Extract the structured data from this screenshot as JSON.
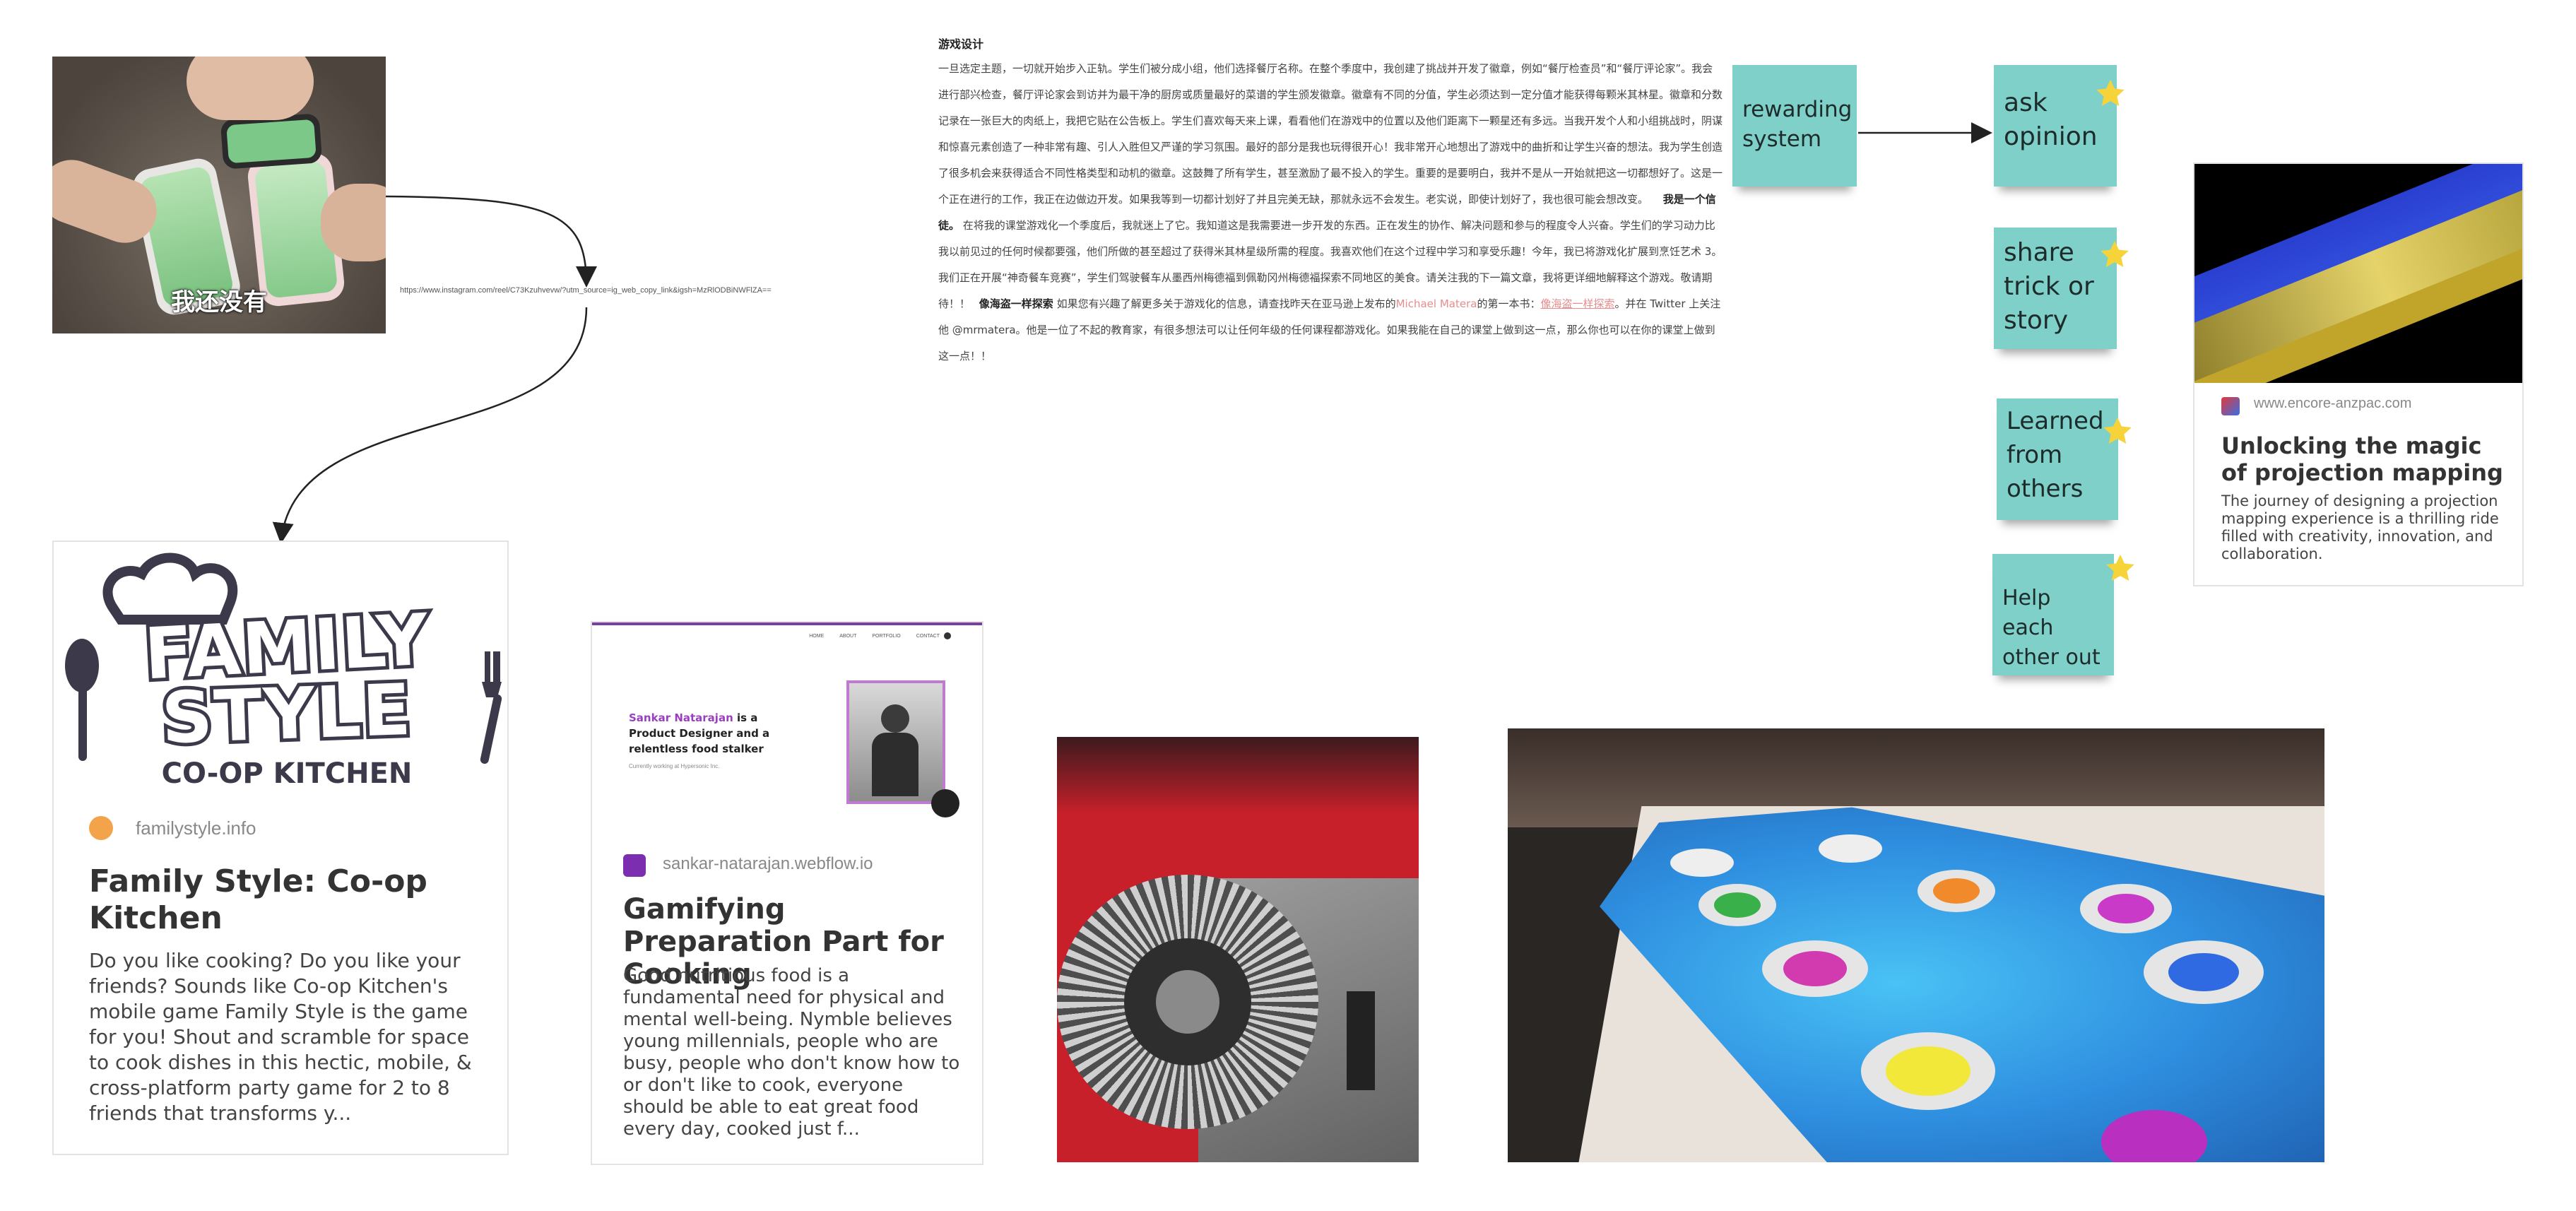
{
  "canvas": {
    "background": "#ffffff"
  },
  "link_card": {
    "url": "https://www.instagram.com/reel/C73Kzuhvevw/?utm_source=ig_web_copy_link&igsh=MzRlODBiNWFlZA=="
  },
  "video_thumb": {
    "caption": "我还没有"
  },
  "family_style": {
    "logo_word1": "FAMILY",
    "logo_word2": "STYLE",
    "logo_sub": "CO-OP KITCHEN",
    "domain": "familystyle.info",
    "title": "Family Style: Co-op Kitchen",
    "description": "Do you like cooking? Do you like your friends? Sounds like Co-op Kitchen's mobile game Family Style is the game for you! Shout and scramble for space to cook dishes in this hectic, mobile, & cross-platform party game for 2 to 8 friends that transforms y..."
  },
  "gamifying": {
    "nav": [
      "HOME",
      "ABOUT",
      "PORTFOLIO",
      "CONTACT"
    ],
    "hero_name": "Sankar Natarajan",
    "hero_line": "is a Product Designer and a relentless food stalker",
    "hero_sub": "Currently working at Hypersonic Inc.",
    "domain": "sankar-natarajan.webflow.io",
    "title": "Gamifying Preparation Part for Cooking",
    "description": "Good nutritious food is a fundamental need for physical and mental well-being. Nymble believes young millennials, people who are busy, people who don't know how to or don't like to cook, everyone should be able to eat great food every day, cooked just f..."
  },
  "doc": {
    "heading": "游戏设计",
    "paragraph_1": "一旦选定主题，一切就开始步入正轨。学生们被分成小组，他们选择餐厅名称。在整个季度中，我创建了挑战并开发了徽章，例如“餐厅检查员”和“餐厅评论家”。我会进行部兴检查，餐厅评论家会到访并为最干净的厨房或质量最好的菜谱的学生颁发徽章。徽章有不同的分值，学生必须达到一定分值才能获得每颗米其林星。徽章和分数记录在一张巨大的肉纸上，我把它贴在公告板上。学生们喜欢每天来上课，看看他们在游戏中的位置以及他们距离下一颗星还有多远。当我开发个人和小组挑战时，阴谋和惊喜元素创造了一种非常有趣、引人入胜但又严谨的学习氛围。最好的部分是我也玩得很开心！我非常开心地想出了游戏中的曲折和让学生兴奋的想法。我为学生创造了很多机会来获得适合不同性格类型和动机的徽章。这鼓舞了所有学生，甚至激励了最不投入的学生。重要的是要明白，我并不是从一开始就把这一切都想好了。这是一个正在进行的工作，我正在边做边开发。如果我等到一切都计划好了并且完美无缺，那就永远不会发生。老实说，即使计划好了，我也很可能会想改变。",
    "bold_1": "我是一个信徒。",
    "paragraph_2": "在将我的课堂游戏化一个季度后，我就迷上了它。我知道这是我需要进一步开发的东西。正在发生的协作、解决问题和参与的程度令人兴奋。学生们的学习动力比我以前见过的任何时候都要强，他们所做的甚至超过了获得米其林星级所需的程度。我喜欢他们在这个过程中学习和享受乐趣！今年，我已将游戏化扩展到烹饪艺术 3。我们正在开展“神奇餐车竞赛”，学生们驾驶餐车从墨西州梅德福到佩勒冈州梅德福探索不同地区的美食。请关注我的下一篇文章，我将更详细地解释这个游戏。敬请期待！！",
    "bold_2": "像海盗一样探索",
    "paragraph_3": "如果您有兴趣了解更多关于游戏化的信息，请查找昨天在亚马逊上发布的",
    "link_1": "Michael Matera",
    "paragraph_4": "的第一本书：",
    "link_2": "像海盗一样探索",
    "paragraph_5": "。并在 Twitter 上关注他 @mrmatera。他是一位了不起的教育家，有很多想法可以让任何年级的任何课程都游戏化。如果我能在自己的课堂上做到这一点，那么你也可以在你的课堂上做到这一点！！"
  },
  "stickies": {
    "rewarding": "rewarding system",
    "ask": "ask opinion",
    "share": "share trick or story",
    "learned": "Learned from others",
    "help": "Help each other out"
  },
  "projection_card": {
    "domain": "www.encore-anzpac.com",
    "title": "Unlocking the magic of projection mapping",
    "description": "The journey of designing a projection mapping experience is a thrilling ride filled with creativity, innovation, and collaboration."
  },
  "colors": {
    "sticky": "#7ed0c9",
    "star": "#f7d33a",
    "link": "#e88c8c",
    "logo": "#3c3a4a",
    "water": "#2f8fe0"
  }
}
